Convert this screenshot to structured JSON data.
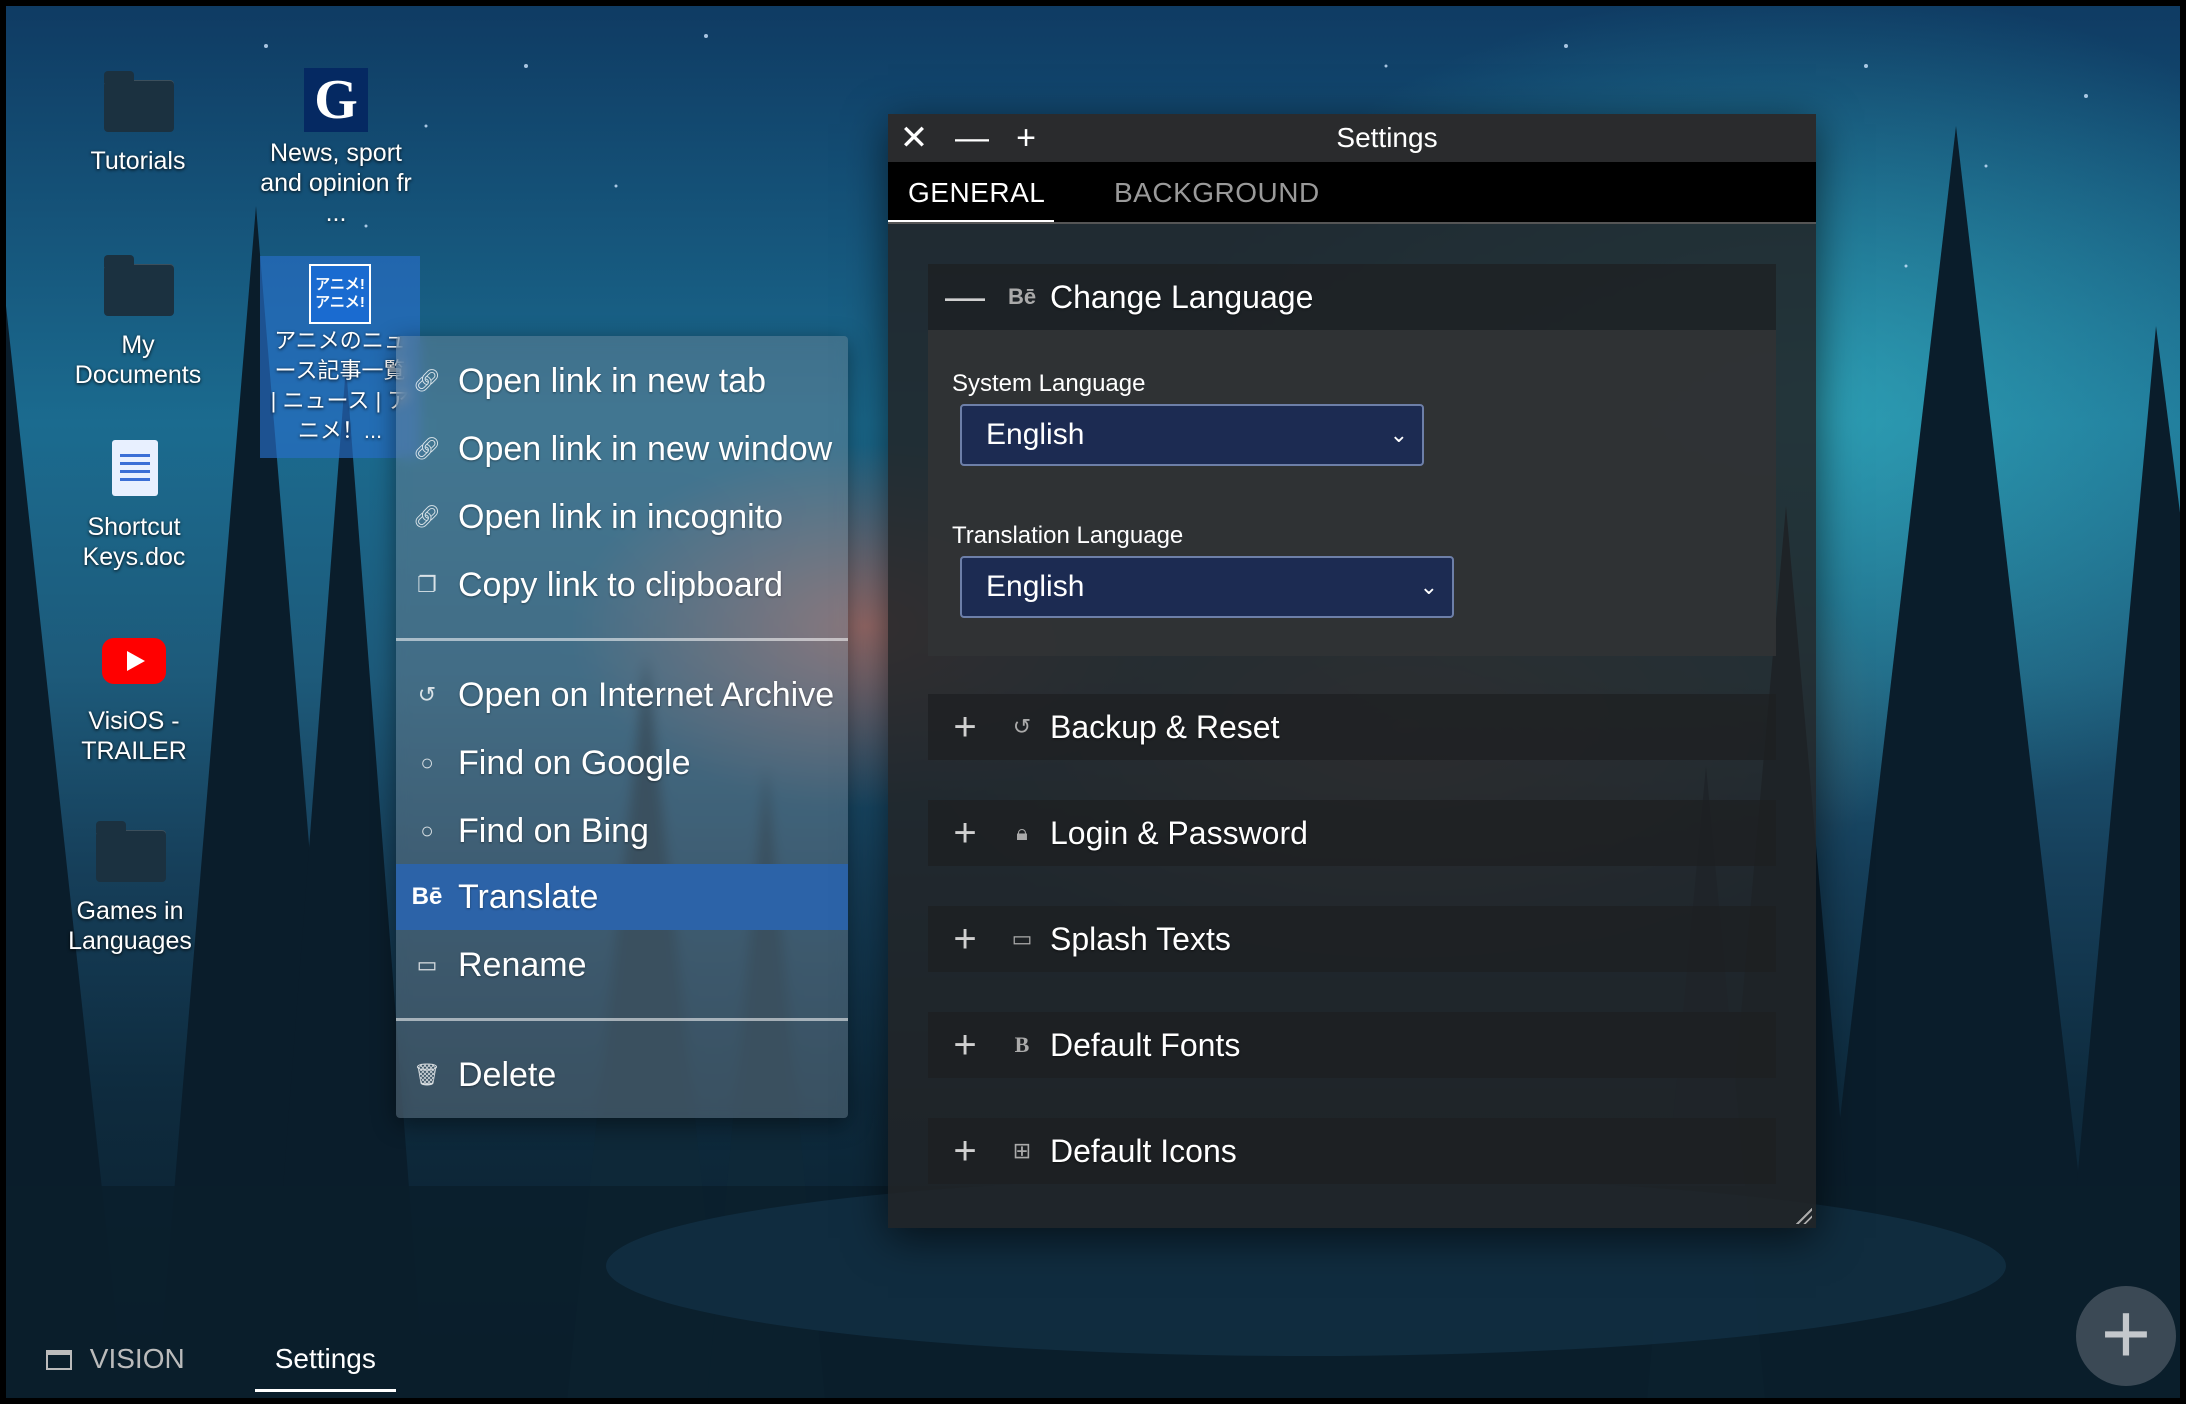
{
  "desktop": {
    "icons": [
      {
        "label": "Tutorials"
      },
      {
        "label": "News, sport and opinion fr ..."
      },
      {
        "label": "My Documents"
      },
      {
        "label": "アニメのニュース記事一覧 | ニュース | アニメ！..."
      },
      {
        "label": "Shortcut Keys.doc"
      },
      {
        "label": "VisiOS - TRAILER"
      },
      {
        "label": "Games in Languages"
      }
    ],
    "anime_badge_line1": "アニメ!",
    "anime_badge_line2": "アニメ!",
    "guardian_letter": "G"
  },
  "context_menu": {
    "items": [
      {
        "label": "Open link in new tab",
        "icon": "link-icon"
      },
      {
        "label": "Open link in new window",
        "icon": "link-icon"
      },
      {
        "label": "Open link in incognito",
        "icon": "link-icon"
      },
      {
        "label": "Copy link to clipboard",
        "icon": "copy-icon"
      },
      {
        "label": "Open on Internet Archive",
        "icon": "history-icon"
      },
      {
        "label": "Find on Google",
        "icon": "search-icon"
      },
      {
        "label": "Find on Bing",
        "icon": "search-icon"
      },
      {
        "label": "Translate",
        "icon": "translate-icon",
        "active": true
      },
      {
        "label": "Rename",
        "icon": "comment-icon"
      },
      {
        "label": "Delete",
        "icon": "trash-icon"
      }
    ],
    "translate_glyph": "Bē"
  },
  "settings": {
    "title": "Settings",
    "tabs": [
      {
        "label": "GENERAL",
        "active": true
      },
      {
        "label": "BACKGROUND",
        "active": false
      }
    ],
    "change_language": {
      "title": "Change Language",
      "icon_glyph": "Bē",
      "system_language_label": "System Language",
      "system_language_value": "English",
      "translation_language_label": "Translation Language",
      "translation_language_value": "English"
    },
    "sections": [
      {
        "title": "Backup & Reset",
        "icon": "history-icon"
      },
      {
        "title": "Login & Password",
        "icon": "lock-icon"
      },
      {
        "title": "Splash Texts",
        "icon": "comment-icon"
      },
      {
        "title": "Default Fonts",
        "icon": "font-icon",
        "glyph": "B"
      },
      {
        "title": "Default Icons",
        "icon": "grid-icon"
      }
    ]
  },
  "taskbar": {
    "items": [
      {
        "label": "VISION",
        "active": false
      },
      {
        "label": "Settings",
        "active": true
      }
    ]
  },
  "fab_label": "+"
}
